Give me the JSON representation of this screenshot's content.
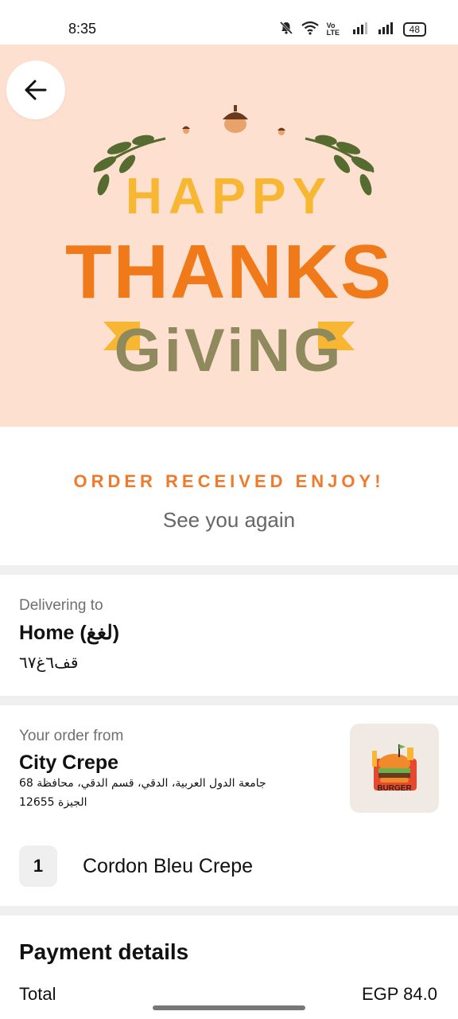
{
  "status_bar": {
    "time": "8:35",
    "battery": "48",
    "icons": [
      "bell-off-icon",
      "wifi-icon",
      "volte-icon",
      "signal-icon",
      "signal-icon",
      "battery-icon"
    ],
    "volte_label": "Vo LTE"
  },
  "hero": {
    "back_icon": "arrow-left-icon",
    "banner_line1": "HAPPY",
    "banner_line2": "THANKS",
    "banner_line3": "GiViNG",
    "colors": {
      "background": "#fde0cf",
      "happy": "#f7b733",
      "thanks": "#f07a1a",
      "giving": "#8a8a5a",
      "leaf": "#556b2f"
    }
  },
  "confirmation": {
    "title": "ORDER RECEIVED ENJOY!",
    "subtitle": "See you again"
  },
  "delivery": {
    "label": "Delivering to",
    "name": "Home (لغغ)",
    "address": "قف٦غ٦٧"
  },
  "order": {
    "label": "Your order from",
    "restaurant": "City Crepe",
    "address_line1": "جامعة الدول العربية، الدقي، قسم الدقي، محافظة 68",
    "address_line2": "الجيزة 12655",
    "logo_text": "BURGER",
    "items": [
      {
        "qty": "1",
        "name": "Cordon Bleu Crepe"
      }
    ]
  },
  "payment": {
    "title": "Payment details",
    "total_label": "Total",
    "total_value": "EGP 84.0"
  }
}
